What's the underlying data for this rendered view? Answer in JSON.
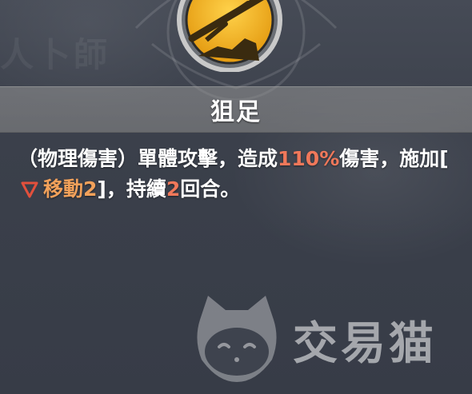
{
  "background": {
    "faded_text": "人卜師"
  },
  "skill": {
    "icon": "lightning-sword-icon",
    "name": "狙足",
    "description": {
      "part1": "（物理傷害）單體攻擊，造成",
      "damage_percent": "110%",
      "part2": "傷害，施加[",
      "debuff_name": "移動",
      "debuff_level": "2",
      "part3": "]，持續",
      "duration": "2",
      "part4": "回合。"
    }
  },
  "watermark": {
    "icon": "cat-logo-icon",
    "text": "交易猫"
  },
  "colors": {
    "highlight_number": "#f0785a",
    "debuff_text": "#f2a15a",
    "debuff_icon": "#e2503c",
    "icon_gold": "#f4b81e"
  }
}
